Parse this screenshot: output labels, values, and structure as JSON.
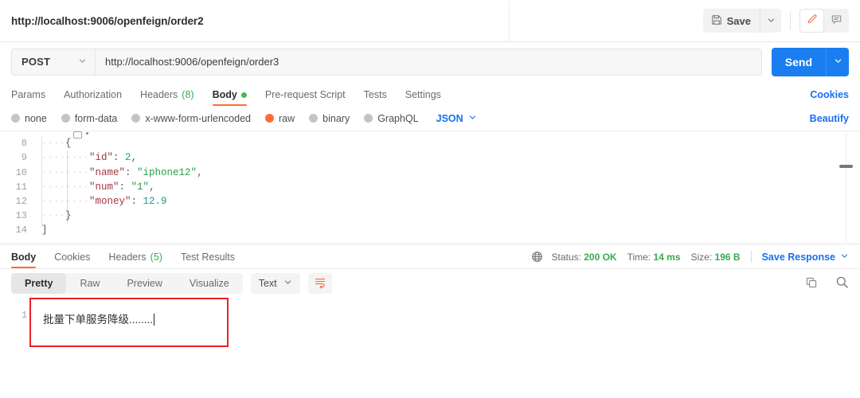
{
  "tab": {
    "title": "http://localhost:9006/openfeign/order2"
  },
  "toolbar": {
    "save_label": "Save",
    "save_icon": "floppy-disk-icon",
    "save_caret_icon": "chevron-down-icon",
    "edit_icon": "pencil-icon",
    "comment_icon": "comment-icon",
    "accent": "#ff6c37"
  },
  "request": {
    "method": "POST",
    "method_caret_icon": "chevron-down-icon",
    "url": "http://localhost:9006/openfeign/order3",
    "url_placeholder": "Enter URL or paste text",
    "send_label": "Send",
    "send_caret_icon": "chevron-down-icon",
    "send_color": "#1a7ef0"
  },
  "request_tabs": {
    "items": [
      {
        "label": "Params",
        "active": false,
        "count": "",
        "dot": false
      },
      {
        "label": "Authorization",
        "active": false,
        "count": "",
        "dot": false
      },
      {
        "label": "Headers",
        "active": false,
        "count": "(8)",
        "dot": false
      },
      {
        "label": "Body",
        "active": true,
        "count": "",
        "dot": true
      },
      {
        "label": "Pre-request Script",
        "active": false,
        "count": "",
        "dot": false
      },
      {
        "label": "Tests",
        "active": false,
        "count": "",
        "dot": false
      },
      {
        "label": "Settings",
        "active": false,
        "count": "",
        "dot": false
      }
    ],
    "cookies_link": "Cookies"
  },
  "body_type": {
    "options": [
      {
        "label": "none",
        "selected": false
      },
      {
        "label": "form-data",
        "selected": false
      },
      {
        "label": "x-www-form-urlencoded",
        "selected": false
      },
      {
        "label": "raw",
        "selected": true
      },
      {
        "label": "binary",
        "selected": false
      },
      {
        "label": "GraphQL",
        "selected": false
      }
    ],
    "format": "JSON",
    "format_caret_icon": "chevron-down-icon",
    "beautify_link": "Beautify"
  },
  "editor": {
    "lines": [
      {
        "num": "8",
        "indent": "    ",
        "content": "{",
        "type": "punc"
      },
      {
        "num": "9",
        "indent": "        ",
        "key": "\"id\"",
        "sep": ": ",
        "value": "2",
        "value_type": "num",
        "tail": ","
      },
      {
        "num": "10",
        "indent": "        ",
        "key": "\"name\"",
        "sep": ": ",
        "value": "\"iphone12\"",
        "value_type": "str",
        "tail": ","
      },
      {
        "num": "11",
        "indent": "        ",
        "key": "\"num\"",
        "sep": ": ",
        "value": "\"1\"",
        "value_type": "str",
        "tail": ","
      },
      {
        "num": "12",
        "indent": "        ",
        "key": "\"money\"",
        "sep": ": ",
        "value": "12.9",
        "value_type": "num",
        "tail": ""
      },
      {
        "num": "13",
        "indent": "    ",
        "content": "}",
        "type": "punc"
      },
      {
        "num": "14",
        "indent": "",
        "content": "]",
        "type": "punc"
      }
    ]
  },
  "response_tabs": {
    "items": [
      {
        "label": "Body",
        "active": true,
        "count": ""
      },
      {
        "label": "Cookies",
        "active": false,
        "count": ""
      },
      {
        "label": "Headers",
        "active": false,
        "count": "(5)"
      },
      {
        "label": "Test Results",
        "active": false,
        "count": ""
      }
    ]
  },
  "status": {
    "globe_icon": "globe-icon",
    "status_label": "Status:",
    "status_value": "200 OK",
    "time_label": "Time:",
    "time_value": "14 ms",
    "size_label": "Size:",
    "size_value": "196 B",
    "save_response": "Save Response",
    "save_response_caret_icon": "chevron-down-icon",
    "ok_color": "#3aa94f"
  },
  "response_toolbar": {
    "views": [
      {
        "label": "Pretty",
        "active": true
      },
      {
        "label": "Raw",
        "active": false
      },
      {
        "label": "Preview",
        "active": false
      },
      {
        "label": "Visualize",
        "active": false
      }
    ],
    "format": "Text",
    "format_caret_icon": "chevron-down-icon",
    "wrap_icon": "wrap-text-icon",
    "copy_icon": "copy-icon",
    "search_icon": "search-icon"
  },
  "response_body": {
    "line_number": "1",
    "text": "批量下单服务降级........"
  }
}
